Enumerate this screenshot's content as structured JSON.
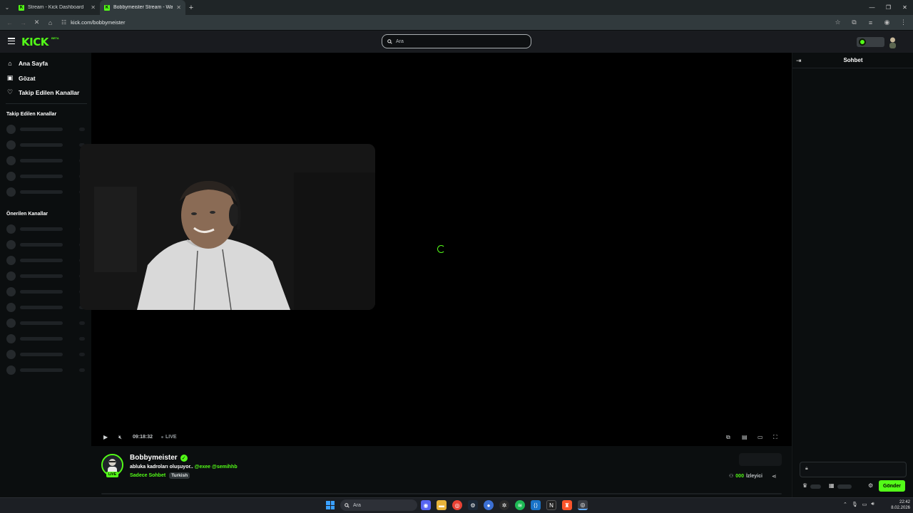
{
  "browser": {
    "tabs": [
      {
        "title": "Stream - Kick Dashboard",
        "active": false
      },
      {
        "title": "Bobbymeister Stream - Watch L",
        "active": true
      }
    ],
    "url": "kick.com/bobbymeister"
  },
  "header": {
    "logo": "KICK",
    "beta": "BETA",
    "search_placeholder": "Ara"
  },
  "sidebar": {
    "nav": [
      {
        "label": "Ana Sayfa",
        "icon": "home-icon"
      },
      {
        "label": "Gözat",
        "icon": "browse-icon"
      },
      {
        "label": "Takip Edilen Kanallar",
        "icon": "heart-icon"
      }
    ],
    "followed_title": "Takip Edilen Kanallar",
    "recommended_title": "Önerilen Kanallar"
  },
  "player": {
    "time": "09:18:32",
    "live_label": "LIVE"
  },
  "stream": {
    "streamer": "Bobbymeister",
    "live_badge": "LIVE",
    "title_text": "abluka kadroları oluşuyor.. ",
    "mentions": "@exee @semihhb",
    "category": "Sadece Sohbet",
    "language": "Turkish",
    "viewer_count": "000",
    "viewer_label": "İzleyici"
  },
  "chat": {
    "title": "Sohbet",
    "send_label": "Gönder"
  },
  "taskbar": {
    "search_placeholder": "Ara",
    "time": "22:42",
    "date": "8.02.2026"
  },
  "colors": {
    "brand": "#53fc18",
    "background": "#0b0e0f",
    "header": "#191b1f"
  }
}
